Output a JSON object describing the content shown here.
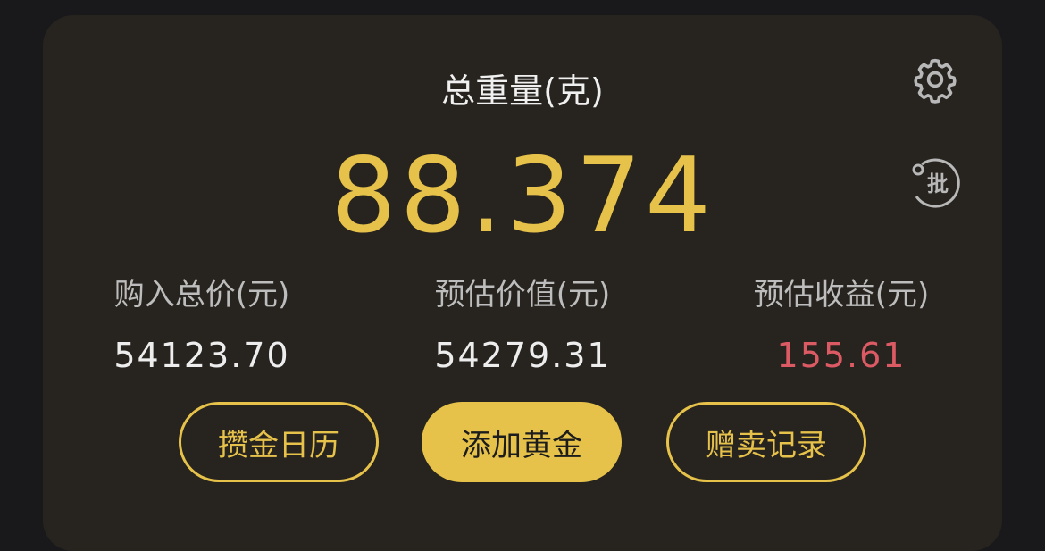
{
  "header": {
    "title": "总重量(克)",
    "total_weight": "88.374"
  },
  "icons": {
    "settings": "gear-icon",
    "batch": "batch-icon",
    "batch_glyph": "批"
  },
  "stats": [
    {
      "label": "购入总价(元)",
      "value": "54123.70"
    },
    {
      "label": "预估价值(元)",
      "value": "54279.31"
    },
    {
      "label": "预估收益(元)",
      "value": "155.61"
    }
  ],
  "actions": {
    "calendar": "攒金日历",
    "add_gold": "添加黄金",
    "records": "赠卖记录"
  },
  "colors": {
    "accent_gold": "#e6c24a",
    "profit_red": "#dc5a64",
    "card_bg": "#27231f"
  }
}
